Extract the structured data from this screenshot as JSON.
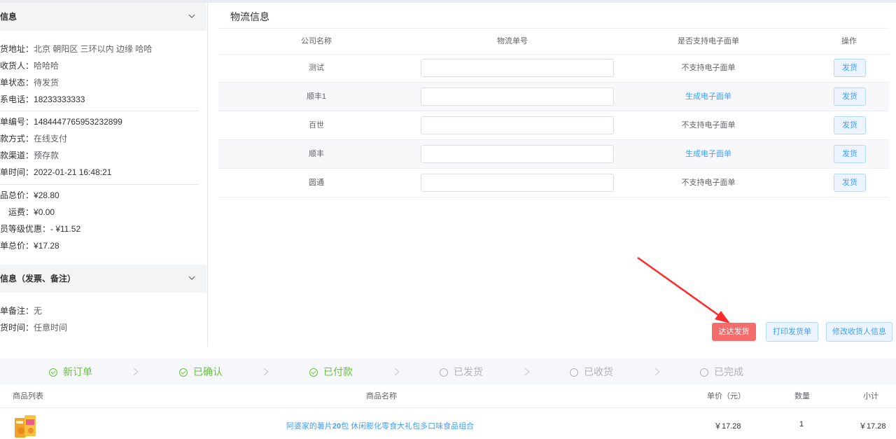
{
  "left": {
    "sec1_title": "信息",
    "group1": [
      {
        "k": "货地址：",
        "v": "北京 朝阳区 三环以内 边缘 哈哈"
      },
      {
        "k": "收货人：",
        "v": "哈哈哈"
      },
      {
        "k": "单状态：",
        "v": "待发货"
      },
      {
        "k": "系电话：",
        "v": "18233333333"
      }
    ],
    "group2": [
      {
        "k": "单编号：",
        "v": "1484447765953232899"
      },
      {
        "k": "款方式：",
        "v": "在线支付"
      },
      {
        "k": "款渠道：",
        "v": "预存款"
      },
      {
        "k": "单时间：",
        "v": "2022-01-21 16:48:21"
      }
    ],
    "group3": [
      {
        "k": "品总价：",
        "v": "¥28.80"
      },
      {
        "k": "运费：",
        "v": "¥0.00"
      },
      {
        "k": "员等级优惠：",
        "v": "- ¥11.52"
      },
      {
        "k": "单总价：",
        "v": "¥17.28"
      }
    ],
    "sec2_title": "信息（发票、备注）",
    "group4": [
      {
        "k": "单备注：",
        "v": "无"
      },
      {
        "k": "货时间：",
        "v": "任意时间"
      }
    ]
  },
  "logistics": {
    "title": "物流信息",
    "headers": [
      "公司名称",
      "物流单号",
      "是否支持电子面单",
      "操作"
    ],
    "rows": [
      {
        "name": "测试",
        "tracking": "",
        "support": "不支持电子面单",
        "support_link": false,
        "action": "发货"
      },
      {
        "name": "顺丰1",
        "tracking": "",
        "support": "生成电子面单",
        "support_link": true,
        "action": "发货"
      },
      {
        "name": "百世",
        "tracking": "",
        "support": "不支持电子面单",
        "support_link": false,
        "action": "发货"
      },
      {
        "name": "顺丰",
        "tracking": "",
        "support": "生成电子面单",
        "support_link": true,
        "action": "发货"
      },
      {
        "name": "圆通",
        "tracking": "",
        "support": "不支持电子面单",
        "support_link": false,
        "action": "发货"
      }
    ],
    "buttons": {
      "dada": "达达发货",
      "print": "打印发货单",
      "edit": "修改收货人信息"
    }
  },
  "steps": [
    {
      "label": "新订单",
      "done": true
    },
    {
      "label": "已确认",
      "done": true
    },
    {
      "label": "已付款",
      "done": true
    },
    {
      "label": "已发货",
      "done": false
    },
    {
      "label": "已收货",
      "done": false
    },
    {
      "label": "已完成",
      "done": false
    }
  ],
  "products": {
    "headers": {
      "list": "商品列表",
      "name": "商品名称",
      "price": "单价（元）",
      "qty": "数量",
      "subtotal": "小计"
    },
    "items": [
      {
        "name_prefix": "阿婆家的薯片",
        "name_bold": "20",
        "name_suffix": "包 休闲膨化零食大礼包多口味食品组合",
        "price": "￥17.28",
        "qty": "1",
        "subtotal": "￥17.28"
      }
    ]
  },
  "colors": {
    "accent": "#409eff",
    "success": "#67c23a",
    "danger": "#f56c6c",
    "arrow": "#ff2a2a"
  }
}
